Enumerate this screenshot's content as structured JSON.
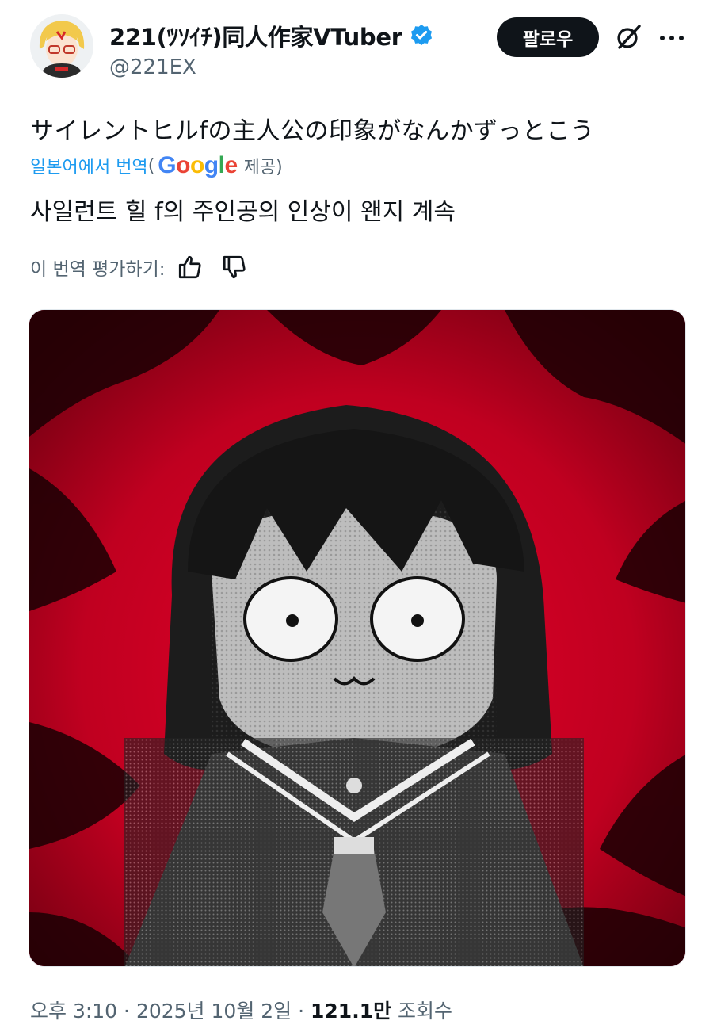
{
  "author": {
    "display_name": "221(ﾂｿｲﾁ)同人作家VTuber",
    "handle": "@221EX",
    "verified": true,
    "avatar_icon": "avatar-image"
  },
  "actions": {
    "follow_label": "팔로우",
    "grok_icon": "grok-icon",
    "more_icon": "more-dots-icon"
  },
  "post": {
    "original_text": "サイレントヒルfの主人公の印象がなんかずっとこう",
    "translated_from": "일본어에서 번역",
    "translation_provider": "Google",
    "provided_suffix": "제공)",
    "open_paren": "(",
    "translation_text": "사일런트 힐 f의 주인공의 인상이 왠지 계속",
    "rate_label": "이 번역 평가하기:",
    "media_alt": "illustration"
  },
  "meta": {
    "time": "오후 3:10",
    "separator": " · ",
    "date": "2025년 10월 2일",
    "views_count": "121.1만",
    "views_label": "조회수"
  },
  "colors": {
    "accent": "#1d9bf0",
    "text": "#0f1419",
    "secondary": "#536471",
    "media_red": "#c4001c"
  }
}
